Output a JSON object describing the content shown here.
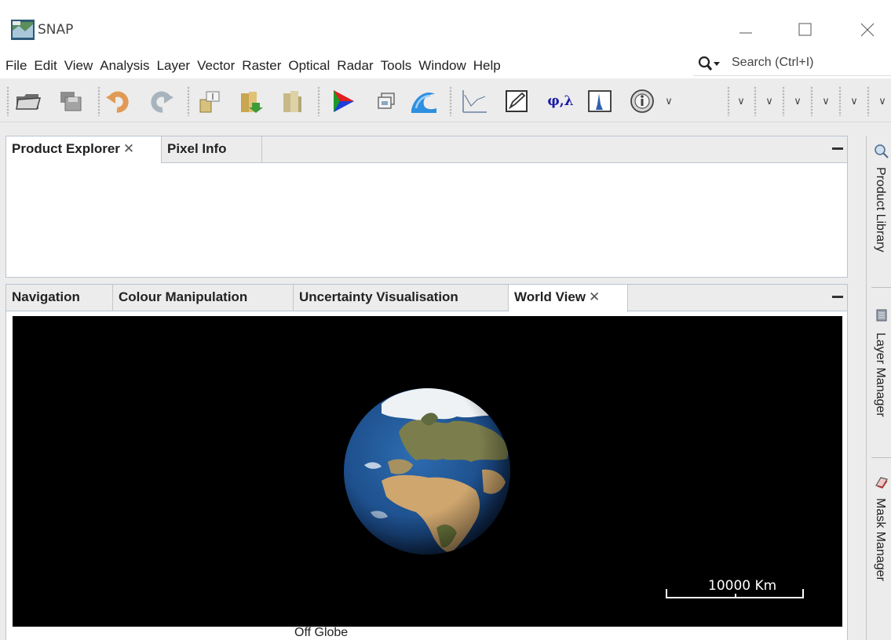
{
  "window": {
    "title": "SNAP"
  },
  "menu": {
    "items": [
      "File",
      "Edit",
      "View",
      "Analysis",
      "Layer",
      "Vector",
      "Raster",
      "Optical",
      "Radar",
      "Tools",
      "Window",
      "Help"
    ]
  },
  "search": {
    "placeholder": "Search (Ctrl+I)"
  },
  "toolbar": {
    "geocoding_label": "φ,λ",
    "icons": [
      "open-product-icon",
      "save-product-icon",
      "undo-icon",
      "redo-icon",
      "band-maths-icon",
      "import-icon",
      "export-icon",
      "rgb-image-icon",
      "open-window-icon",
      "wave-icon",
      "plot-icon",
      "pen-icon",
      "geo-coding-icon",
      "histogram-icon",
      "information-icon"
    ]
  },
  "top_panel": {
    "tabs": [
      {
        "label": "Product Explorer",
        "closable": true,
        "active": true
      },
      {
        "label": "Pixel Info",
        "closable": false,
        "active": false
      }
    ]
  },
  "bottom_panel": {
    "tabs": [
      {
        "label": "Navigation",
        "closable": false,
        "active": false
      },
      {
        "label": "Colour Manipulation",
        "closable": false,
        "active": false
      },
      {
        "label": "Uncertainty Visualisation",
        "closable": false,
        "active": false
      },
      {
        "label": "World View",
        "closable": true,
        "active": true
      }
    ]
  },
  "world_view": {
    "scale_label": "10000 Km",
    "status": "Off Globe"
  },
  "sidebar": {
    "items": [
      "Product Library",
      "Layer Manager",
      "Mask Manager"
    ]
  },
  "colors": {
    "panel_border": "#b9c5d3",
    "toolbar_bg": "#ececec",
    "globe_bg": "#000000",
    "ocean": "#1f4f8f",
    "land": "#c9a675"
  }
}
